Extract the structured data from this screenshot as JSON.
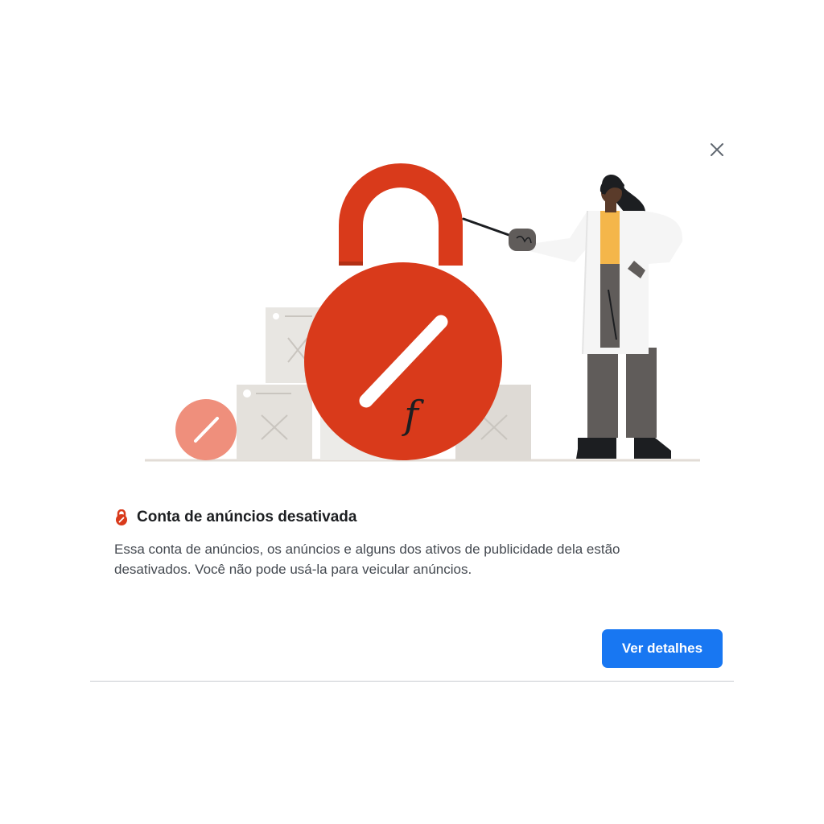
{
  "dialog": {
    "title": "Conta de anúncios desativada",
    "body": "Essa conta de anúncios, os anúncios e alguns dos ativos de publicidade dela estão desativados. Você não pode usá-la para veicular anúncios.",
    "primary_button_label": "Ver detalhes",
    "close_icon": "close-icon",
    "title_icon": "lock-icon"
  },
  "illustration": {
    "logo_text": "f"
  },
  "colors": {
    "accent": "#1877f2",
    "danger": "#d93a1b",
    "danger_light": "#ef8f7c",
    "box": "#e6e3de",
    "coat": "#f5f5f5",
    "shirt": "#f4b64a",
    "pants": "#605c5a"
  }
}
